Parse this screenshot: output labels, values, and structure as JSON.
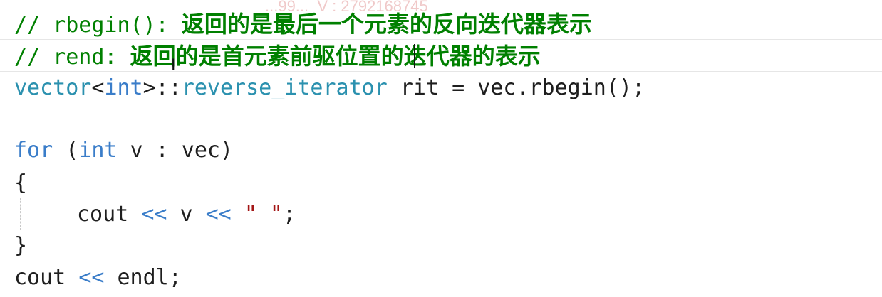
{
  "editor": {
    "line1": {
      "prefix": "// rbegin(): ",
      "cn": "返回的是最后一个元素的反向迭代器表示"
    },
    "line2": {
      "prefix": "// rend: ",
      "cn": "返回的是首元素前驱位置的迭代器的表示"
    },
    "line3": {
      "vector": "vector",
      "lt": "<",
      "int": "int",
      "gt": ">::",
      "reverse_iterator": "reverse_iterator",
      "rest": " rit = vec.rbegin();"
    },
    "line5": {
      "for": "for",
      "open": " (",
      "int": "int",
      "rest": " v : vec)"
    },
    "line6": {
      "text": "{"
    },
    "line7": {
      "cout": "cout ",
      "op1": "<<",
      "mid": " v ",
      "op2": "<<",
      "space": " ",
      "str": "\" \"",
      "end": ";"
    },
    "line8": {
      "text": "}"
    },
    "line9": {
      "cout": "cout ",
      "op": "<<",
      "rest": " endl;"
    }
  },
  "watermark": "...99...  V : 2792168745",
  "colors": {
    "comment": "#008000",
    "keyword": "#3a7dc9",
    "type": "#2b91af",
    "string": "#a31515",
    "text": "#1e1e1e"
  }
}
